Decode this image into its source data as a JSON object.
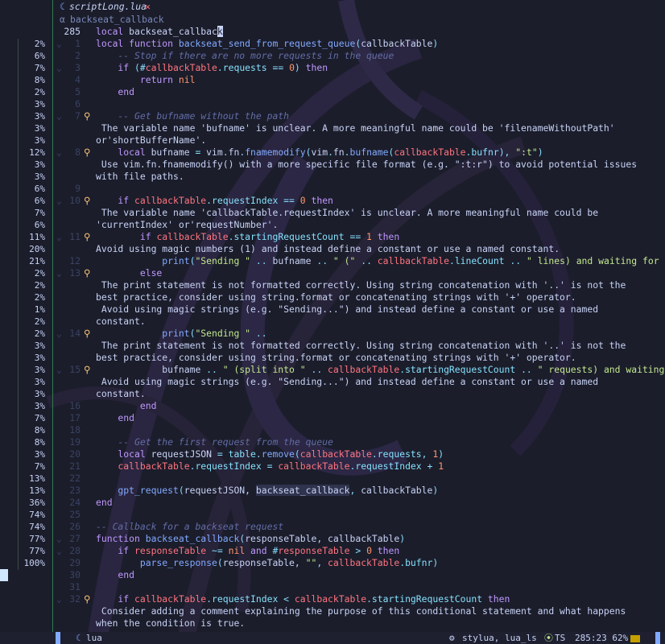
{
  "tab": {
    "icon": "lua-icon",
    "name": "scriptLong.lua",
    "close": "✕"
  },
  "winbar": {
    "icon": "α",
    "crumb": "backseat_callback"
  },
  "left_panel": {
    "percents": [
      "2%",
      "6%",
      "7%",
      "8%",
      "2%",
      "3%",
      "3%",
      "3%",
      "3%",
      "12%",
      "3%",
      "3%",
      "6%",
      "6%",
      "7%",
      "6%",
      "11%",
      "20%",
      "21%",
      "2%",
      "2%",
      "2%",
      "1%",
      "2%",
      "2%",
      "3%",
      "3%",
      "3%",
      "3%",
      "3%",
      "3%",
      "7%",
      "8%",
      "8%",
      "3%",
      "7%",
      "13%",
      "13%",
      "36%",
      "74%",
      "74%",
      "77%",
      "77%",
      "100%"
    ],
    "highlight_row": 45
  },
  "statusline": {
    "ft_icon": "lua-icon",
    "filetype": "lua",
    "cfg_icon": "⚙",
    "formatters": "stylua, lua_ls",
    "ts_icon": "⦿",
    "ts_label": "TS",
    "position": "285:23",
    "percent": "62%"
  },
  "rows": [
    {
      "num": "285",
      "cur": true,
      "code": [
        [
          "k",
          "local "
        ],
        [
          "",
          "backseat_callbac"
        ],
        [
          "cursor",
          "k"
        ]
      ]
    },
    {
      "num": "1",
      "fold": true,
      "code": [
        [
          "k",
          "local function "
        ],
        [
          "f",
          "backseat_send_from_request_queue"
        ],
        [
          "o",
          "("
        ],
        [
          "",
          "callbackTable"
        ],
        [
          "o",
          ")"
        ]
      ]
    },
    {
      "num": "2",
      "code": [
        [
          "c",
          "    -- Stop if there are no more requests in the queue"
        ]
      ]
    },
    {
      "num": "3",
      "fold": true,
      "code": [
        [
          "k",
          "    if "
        ],
        [
          "o",
          "(#"
        ],
        [
          "v",
          "callbackTable"
        ],
        [
          "o",
          "."
        ],
        [
          "p",
          "requests"
        ],
        [
          "o",
          " == "
        ],
        [
          "n",
          "0"
        ],
        [
          "o",
          ") "
        ],
        [
          "k",
          "then"
        ]
      ]
    },
    {
      "num": "4",
      "code": [
        [
          "k",
          "        return "
        ],
        [
          "n",
          "nil"
        ]
      ]
    },
    {
      "num": "5",
      "code": [
        [
          "k",
          "    end"
        ]
      ]
    },
    {
      "num": "6",
      "code": []
    },
    {
      "num": "7",
      "fold": true,
      "bulb": true,
      "code": [
        [
          "c",
          "    -- Get bufname without the path"
        ]
      ]
    },
    {
      "vtext": " The variable name 'bufname' is unclear. A more meaningful name could be 'filenameWithoutPath'"
    },
    {
      "vtext": "or'shortBufferName'."
    },
    {
      "num": "8",
      "fold": true,
      "bulb": true,
      "code": [
        [
          "k",
          "    local "
        ],
        [
          "",
          "bufname "
        ],
        [
          "o",
          "= "
        ],
        [
          "",
          "vim"
        ],
        [
          "o",
          "."
        ],
        [
          "",
          "fn"
        ],
        [
          "o",
          "."
        ],
        [
          "f",
          "fnamemodify"
        ],
        [
          "o",
          "("
        ],
        [
          "",
          "vim"
        ],
        [
          "o",
          "."
        ],
        [
          "",
          "fn"
        ],
        [
          "o",
          "."
        ],
        [
          "f",
          "bufname"
        ],
        [
          "o",
          "("
        ],
        [
          "v",
          "callbackTable"
        ],
        [
          "o",
          "."
        ],
        [
          "p",
          "bufnr"
        ],
        [
          "o",
          "), "
        ],
        [
          "s",
          "\":t\""
        ],
        [
          "o",
          ")"
        ]
      ]
    },
    {
      "vtext": " Use vim.fn.fnamemodify() with a more specific file format (e.g. \":t:r\") to avoid potential issues"
    },
    {
      "vtext": "with file paths."
    },
    {
      "num": "9",
      "code": []
    },
    {
      "num": "10",
      "fold": true,
      "bulb": true,
      "code": [
        [
          "k",
          "    if "
        ],
        [
          "v",
          "callbackTable"
        ],
        [
          "o",
          "."
        ],
        [
          "p",
          "requestIndex"
        ],
        [
          "o",
          " == "
        ],
        [
          "n",
          "0"
        ],
        [
          "k",
          " then"
        ]
      ]
    },
    {
      "vtext": " The variable name 'callbackTable.requestIndex' is unclear. A more meaningful name could be"
    },
    {
      "vtext": "'currentIndex' or'requestNumber'."
    },
    {
      "num": "11",
      "fold": true,
      "bulb": true,
      "code": [
        [
          "k",
          "        if "
        ],
        [
          "v",
          "callbackTable"
        ],
        [
          "o",
          "."
        ],
        [
          "p",
          "startingRequestCount"
        ],
        [
          "o",
          " == "
        ],
        [
          "n",
          "1"
        ],
        [
          "k",
          " then"
        ]
      ]
    },
    {
      "vtext": "Avoid using magic numbers (1) and instead define a constant or use a named constant."
    },
    {
      "num": "12",
      "code": [
        [
          "",
          "            "
        ],
        [
          "f",
          "print"
        ],
        [
          "o",
          "("
        ],
        [
          "s",
          "\"Sending \""
        ],
        [
          "o",
          " .. "
        ],
        [
          "",
          "bufname"
        ],
        [
          "o",
          " .. "
        ],
        [
          "s",
          "\" (\""
        ],
        [
          "o",
          " .. "
        ],
        [
          "v",
          "callbackTable"
        ],
        [
          "o",
          "."
        ],
        [
          "p",
          "lineCount"
        ],
        [
          "o",
          " .. "
        ],
        [
          "s",
          "\" lines) and waiting for respons"
        ]
      ]
    },
    {
      "num": "13",
      "fold": true,
      "bulb": true,
      "code": [
        [
          "k",
          "        else"
        ]
      ]
    },
    {
      "vtext": " The print statement is not formatted correctly. Using string concatenation with '..' is not the"
    },
    {
      "vtext": "best practice, consider using string.format or concatenating strings with '+' operator."
    },
    {
      "vtext": " Avoid using magic strings (e.g. \"Sending...\") and instead define a constant or use a named"
    },
    {
      "vtext": "constant."
    },
    {
      "num": "14",
      "fold": true,
      "bulb": true,
      "code": [
        [
          "",
          "            "
        ],
        [
          "f",
          "print"
        ],
        [
          "o",
          "("
        ],
        [
          "s",
          "\"Sending \""
        ],
        [
          "o",
          " .."
        ]
      ]
    },
    {
      "vtext": " The print statement is not formatted correctly. Using string concatenation with '..' is not the"
    },
    {
      "vtext": "best practice, consider using string.format or concatenating strings with '+' operator."
    },
    {
      "num": "15",
      "fold": true,
      "bulb": true,
      "code": [
        [
          "",
          "            bufname "
        ],
        [
          "o",
          ".. "
        ],
        [
          "s",
          "\" (split into \""
        ],
        [
          "o",
          " .. "
        ],
        [
          "v",
          "callbackTable"
        ],
        [
          "o",
          "."
        ],
        [
          "p",
          "startingRequestCount"
        ],
        [
          "o",
          " .. "
        ],
        [
          "s",
          "\" requests) and waiting for re"
        ]
      ]
    },
    {
      "vtext": " Avoid using magic strings (e.g. \"Sending...\") and instead define a constant or use a named"
    },
    {
      "vtext": "constant."
    },
    {
      "num": "16",
      "code": [
        [
          "k",
          "        end"
        ]
      ]
    },
    {
      "num": "17",
      "code": [
        [
          "k",
          "    end"
        ]
      ]
    },
    {
      "num": "18",
      "code": []
    },
    {
      "num": "19",
      "code": [
        [
          "c",
          "    -- Get the first request from the queue"
        ]
      ]
    },
    {
      "num": "20",
      "code": [
        [
          "k",
          "    local "
        ],
        [
          "",
          "requestJSON "
        ],
        [
          "o",
          "= "
        ],
        [
          "p",
          "table"
        ],
        [
          "o",
          "."
        ],
        [
          "f",
          "remove"
        ],
        [
          "o",
          "("
        ],
        [
          "v",
          "callbackTable"
        ],
        [
          "o",
          "."
        ],
        [
          "p",
          "requests"
        ],
        [
          "o",
          ", "
        ],
        [
          "n",
          "1"
        ],
        [
          "o",
          ")"
        ]
      ]
    },
    {
      "num": "21",
      "code": [
        [
          "v",
          "    callbackTable"
        ],
        [
          "o",
          "."
        ],
        [
          "p",
          "requestIndex"
        ],
        [
          "o",
          " = "
        ],
        [
          "v",
          "callbackTable"
        ],
        [
          "o",
          "."
        ],
        [
          "p",
          "requestIndex"
        ],
        [
          "o",
          " + "
        ],
        [
          "n",
          "1"
        ]
      ]
    },
    {
      "num": "22",
      "code": []
    },
    {
      "num": "23",
      "code": [
        [
          "f",
          "    gpt_request"
        ],
        [
          "o",
          "("
        ],
        [
          "",
          "requestJSON, "
        ],
        [
          "hl",
          "backseat_callback"
        ],
        [
          "o",
          ", "
        ],
        [
          "",
          "callbackTable"
        ],
        [
          "o",
          ")"
        ]
      ]
    },
    {
      "num": "24",
      "code": [
        [
          "k",
          "end"
        ]
      ]
    },
    {
      "num": "25",
      "code": []
    },
    {
      "num": "26",
      "code": [
        [
          "c",
          "-- Callback for a backseat request"
        ]
      ]
    },
    {
      "num": "27",
      "fold": true,
      "code": [
        [
          "k",
          "function "
        ],
        [
          "f",
          "backseat_callback"
        ],
        [
          "o",
          "("
        ],
        [
          "",
          "responseTable, callbackTable"
        ],
        [
          "o",
          ")"
        ]
      ]
    },
    {
      "num": "28",
      "fold": true,
      "code": [
        [
          "k",
          "    if "
        ],
        [
          "v",
          "responseTable"
        ],
        [
          "o",
          " ~= "
        ],
        [
          "n",
          "nil"
        ],
        [
          "k",
          " and "
        ],
        [
          "o",
          "#"
        ],
        [
          "v",
          "responseTable"
        ],
        [
          "o",
          " > "
        ],
        [
          "n",
          "0"
        ],
        [
          "k",
          " then"
        ]
      ]
    },
    {
      "num": "29",
      "code": [
        [
          "f",
          "        parse_response"
        ],
        [
          "o",
          "("
        ],
        [
          "",
          "responseTable, "
        ],
        [
          "s",
          "\"\""
        ],
        [
          "o",
          ", "
        ],
        [
          "v",
          "callbackTable"
        ],
        [
          "o",
          "."
        ],
        [
          "p",
          "bufnr"
        ],
        [
          "o",
          ")"
        ]
      ]
    },
    {
      "num": "30",
      "code": [
        [
          "k",
          "    end"
        ]
      ]
    },
    {
      "num": "31",
      "code": []
    },
    {
      "num": "32",
      "fold": true,
      "bulb": true,
      "code": [
        [
          "k",
          "    if "
        ],
        [
          "v",
          "callbackTable"
        ],
        [
          "o",
          "."
        ],
        [
          "p",
          "requestIndex"
        ],
        [
          "o",
          " < "
        ],
        [
          "v",
          "callbackTable"
        ],
        [
          "o",
          "."
        ],
        [
          "p",
          "startingRequestCount"
        ],
        [
          "k",
          " then"
        ]
      ]
    },
    {
      "vtext": " Consider adding a comment explaining the purpose of this conditional statement and what happens"
    },
    {
      "vtext": "when the condition is true."
    }
  ]
}
